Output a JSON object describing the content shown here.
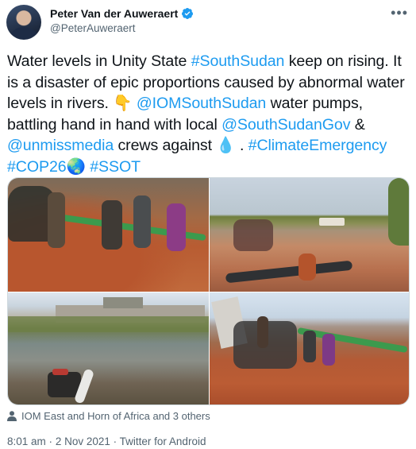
{
  "author": {
    "name": "Peter Van der Auweraert",
    "handle": "@PeterAuweraert",
    "verified": true
  },
  "tweet": {
    "segments": [
      {
        "text": "Water levels in Unity State ",
        "link": false
      },
      {
        "text": "#SouthSudan",
        "link": true
      },
      {
        "text": " keep on rising. It is a disaster of epic proportions caused by abnormal water levels in rivers. ",
        "link": false
      },
      {
        "text": "👇",
        "link": false
      },
      {
        "text": " ",
        "link": false
      },
      {
        "text": "@IOMSouthSudan",
        "link": true
      },
      {
        "text": " water pumps, battling hand in hand with local ",
        "link": false
      },
      {
        "text": "@SouthSudanGov",
        "link": true
      },
      {
        "text": " & ",
        "link": false
      },
      {
        "text": "@unmissmedia",
        "link": true
      },
      {
        "text": " crews against ",
        "link": false
      },
      {
        "text": "💧",
        "link": false
      },
      {
        "text": " . ",
        "link": false
      },
      {
        "text": "#ClimateEmergency",
        "link": true
      },
      {
        "text": " ",
        "link": false
      },
      {
        "text": "#COP26",
        "link": true
      },
      {
        "text": "🌏",
        "link": false
      },
      {
        "text": " ",
        "link": false
      },
      {
        "text": "#SSOT",
        "link": true
      }
    ]
  },
  "media_count": 4,
  "tagged_people": "IOM East and Horn of Africa and 3 others",
  "meta": {
    "time": "8:01 am",
    "date": "2 Nov 2021",
    "source": "Twitter for Android",
    "separator": "·"
  },
  "colors": {
    "link": "#1d9bf0",
    "secondary_text": "#536471",
    "verified_badge": "#1d9bf0"
  },
  "icons": [
    "verified-badge-icon",
    "more-options-icon",
    "tagged-person-icon"
  ]
}
